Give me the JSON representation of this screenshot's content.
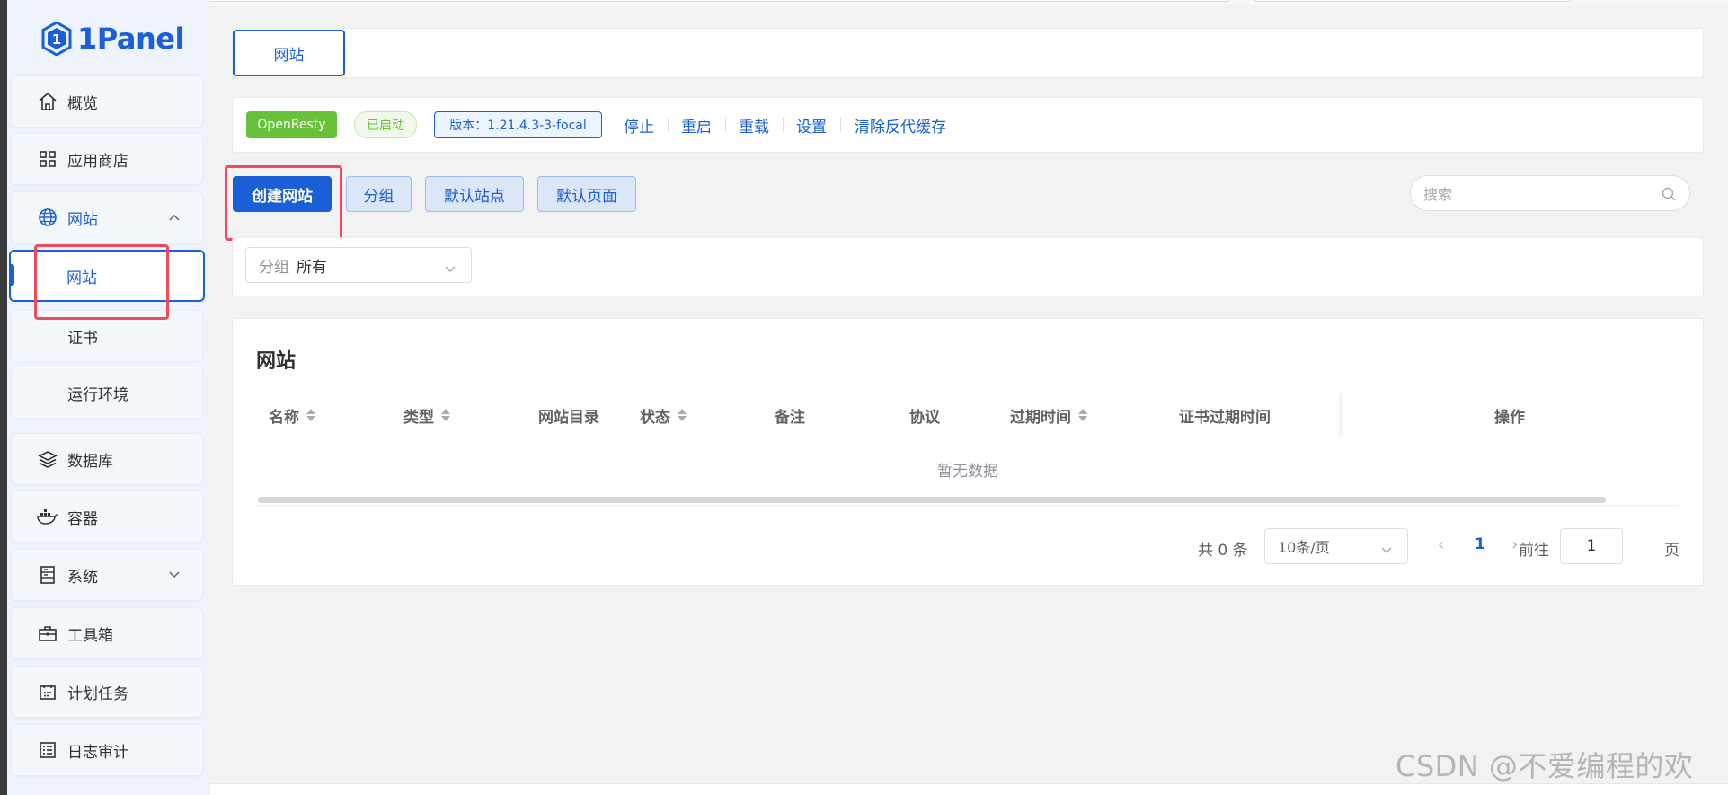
{
  "logo": {
    "text": "1Panel"
  },
  "sidebar": {
    "items": [
      {
        "label": "概览",
        "icon": "home-icon"
      },
      {
        "label": "应用商店",
        "icon": "app-store-icon"
      },
      {
        "label": "网站",
        "icon": "globe-icon",
        "expanded": true
      },
      {
        "label": "数据库",
        "icon": "layers-icon"
      },
      {
        "label": "容器",
        "icon": "docker-icon"
      },
      {
        "label": "系统",
        "icon": "server-icon"
      },
      {
        "label": "工具箱",
        "icon": "toolbox-icon"
      },
      {
        "label": "计划任务",
        "icon": "calendar-icon"
      },
      {
        "label": "日志审计",
        "icon": "log-icon"
      }
    ],
    "sub_items": [
      {
        "label": "网站",
        "active": true
      },
      {
        "label": "证书"
      },
      {
        "label": "运行环境"
      }
    ]
  },
  "tabs": [
    {
      "label": "网站",
      "active": true
    }
  ],
  "status_bar": {
    "app_tag": "OpenResty",
    "state_tag": "已启动",
    "version_tag": "版本：1.21.4.3-3-focal",
    "actions": [
      "停止",
      "重启",
      "重载",
      "设置",
      "清除反代缓存"
    ]
  },
  "toolbar": {
    "create_label": "创建网站",
    "group_label": "分组",
    "default_site_label": "默认站点",
    "default_page_label": "默认页面",
    "search_placeholder": "搜索"
  },
  "filter": {
    "label": "分组",
    "value": "所有"
  },
  "table": {
    "title": "网站",
    "columns": [
      "名称",
      "类型",
      "网站目录",
      "状态",
      "备注",
      "协议",
      "过期时间",
      "证书过期时间",
      "操作"
    ],
    "empty_text": "暂无数据"
  },
  "pagination": {
    "total_text": "共 0 条",
    "page_size": "10条/页",
    "current_page": "1",
    "goto_label": "前往",
    "goto_value": "1",
    "page_suffix": "页"
  },
  "watermark": "CSDN @不爱编程的欢",
  "colors": {
    "primary": "#1a5fd6",
    "success": "#67c23a",
    "highlight": "#ef4a62"
  }
}
